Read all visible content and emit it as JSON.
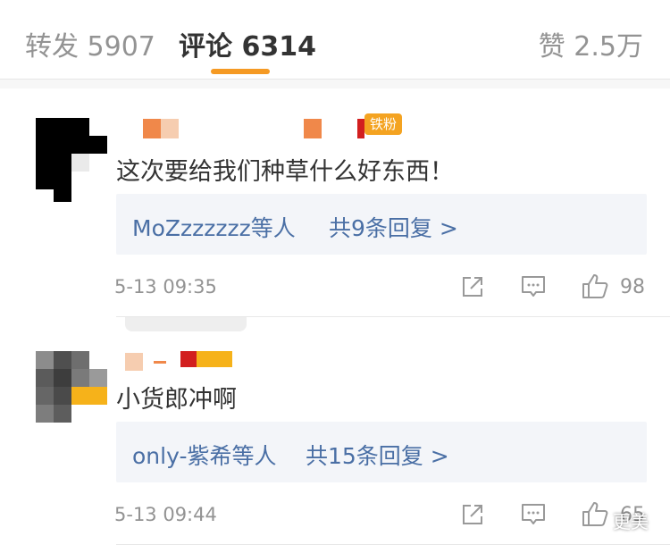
{
  "tabs": {
    "repost": "转发 5907",
    "comments": "评论 6314",
    "likes": "赞 2.5万"
  },
  "comments": [
    {
      "badge": "铁粉",
      "text": "这次要给我们种草什么好东西！",
      "reply_users": "MoZzzzzzz等人",
      "reply_count": "共9条回复 >",
      "time": "5-13 09:35",
      "like_count": "98"
    },
    {
      "text": "小货郎冲啊",
      "reply_users": "only-紫希等人",
      "reply_count": "共15条回复 >",
      "time": "5-13 09:44",
      "like_count": "65"
    }
  ],
  "watermark": "更美",
  "colors": {
    "accent": "#f59a24",
    "link": "#4a6fa5",
    "badge": "#f4a321"
  }
}
